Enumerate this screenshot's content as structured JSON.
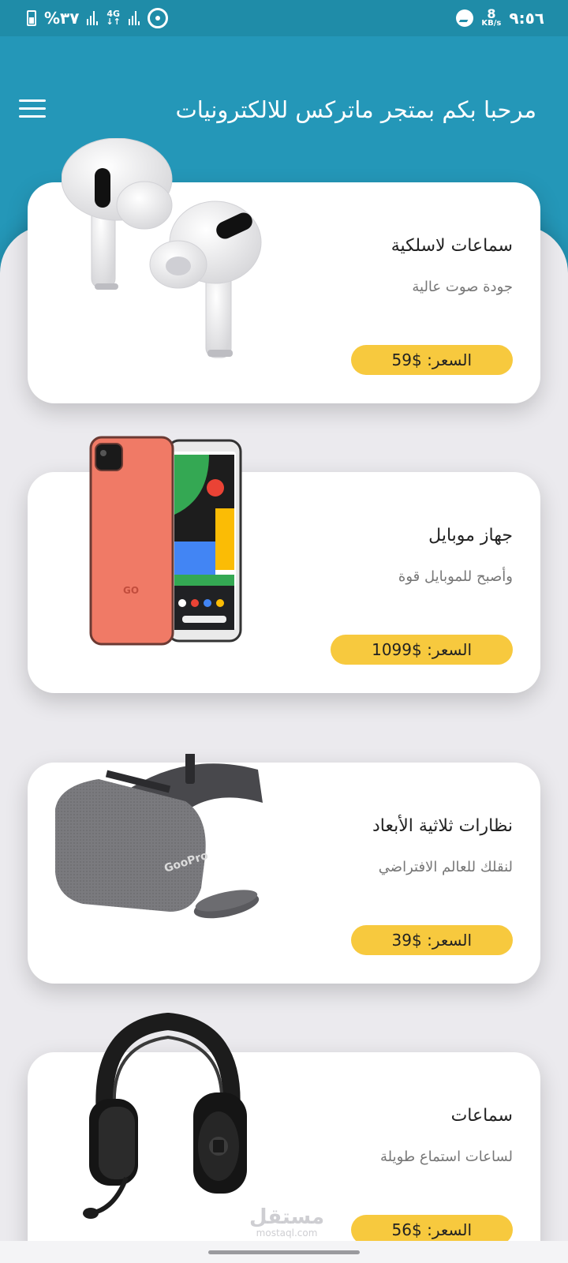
{
  "status_bar": {
    "battery": "%٣٧",
    "network": "4G",
    "speed_value": "8",
    "speed_unit": "KB/s",
    "time": "٩:٥٦",
    "icons": [
      "battery-icon",
      "signal-icon",
      "hotspot-icon",
      "messenger-icon"
    ]
  },
  "header": {
    "title": "مرحبا بكم بمتجر ماتركس للالكترونيات",
    "menu_icon": "hamburger-menu-icon"
  },
  "products": [
    {
      "name": "سماعات لاسلكية",
      "description": "جودة صوت عالية",
      "price": "السعر: $59",
      "image": "wireless-earbuds"
    },
    {
      "name": "جهاز موبايل",
      "description": "وأصبح للموبايل قوة",
      "price": "السعر: $1099",
      "image": "mobile-phone"
    },
    {
      "name": "نظارات ثلاثية الأبعاد",
      "description": "لنقلك للعالم الافتراضي",
      "price": "السعر: $39",
      "image": "vr-headset"
    },
    {
      "name": "سماعات",
      "description": "لساعات استماع طويلة",
      "price": "السعر: $56",
      "image": "headphones"
    }
  ],
  "vr_brand": "GooPro",
  "phone_brand": "GO",
  "watermark": {
    "arabic": "مستقل",
    "latin": "mostaql.com"
  },
  "colors": {
    "header": "#2497b8",
    "price_pill": "#f7c93e",
    "background": "#ebeaee",
    "card": "#ffffff"
  }
}
